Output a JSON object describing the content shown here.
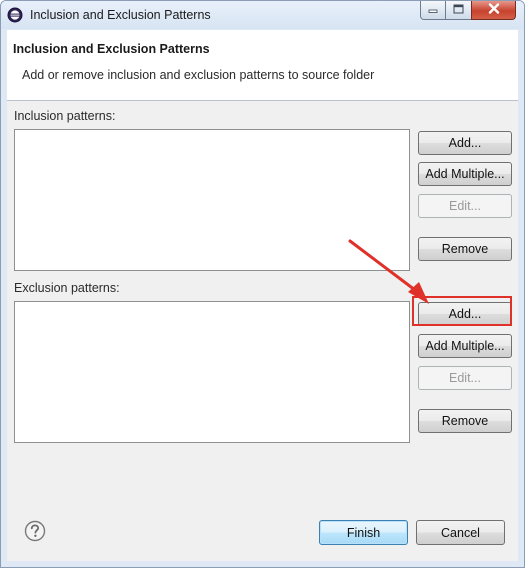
{
  "window": {
    "title": "Inclusion and Exclusion Patterns",
    "controls": {
      "minimize": "minimize-icon",
      "maximize": "maximize-icon",
      "close": "close-icon"
    }
  },
  "header": {
    "title": "Inclusion and Exclusion Patterns",
    "description": "Add or remove inclusion and exclusion patterns to source folder"
  },
  "inclusion": {
    "label": "Inclusion patterns:",
    "items": [],
    "buttons": {
      "add": "Add...",
      "add_multiple": "Add Multiple...",
      "edit": "Edit...",
      "remove": "Remove"
    }
  },
  "exclusion": {
    "label": "Exclusion patterns:",
    "items": [],
    "buttons": {
      "add": "Add...",
      "add_multiple": "Add Multiple...",
      "edit": "Edit...",
      "remove": "Remove"
    }
  },
  "footer": {
    "help_icon": "help-icon",
    "finish": "Finish",
    "cancel": "Cancel"
  },
  "annotation": {
    "color": "#e0302a",
    "target": "exclusion-add-button"
  }
}
